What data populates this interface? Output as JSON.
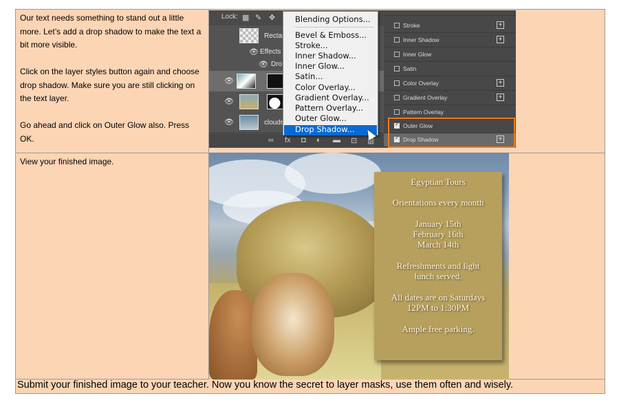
{
  "row1": {
    "paragraphs": [
      "Our text needs something to stand out a little more. Let’s add a drop shadow to make the text a bit more visible.",
      "Click on the layer styles button again and choose drop shadow. Make sure you are still clicking on the text layer.",
      "Go ahead and click on Outer Glow also. Press OK."
    ]
  },
  "row2": {
    "text": "View your finished image."
  },
  "footer": {
    "text": "Submit your finished image to your teacher. Now you know the secret to layer masks, use them often and wisely."
  },
  "layers_panel": {
    "lock_label": "Lock:",
    "layers": [
      "Rectan",
      "Effects",
      "Dro",
      "",
      "",
      "clouds"
    ],
    "menu_items": [
      "Blending Options...",
      "Bevel & Emboss...",
      "Stroke...",
      "Inner Shadow...",
      "Inner Glow...",
      "Satin...",
      "Color Overlay...",
      "Gradient Overlay...",
      "Pattern Overlay...",
      "Outer Glow...",
      "Drop Shadow..."
    ],
    "selected_item": "Drop Shadow..."
  },
  "layer_style_panel": {
    "items": [
      {
        "label": "Stroke",
        "checked": false,
        "plus": true
      },
      {
        "label": "Inner Shadow",
        "checked": false,
        "plus": true
      },
      {
        "label": "Inner Glow",
        "checked": false,
        "plus": false
      },
      {
        "label": "Satin",
        "checked": false,
        "plus": false
      },
      {
        "label": "Color Overlay",
        "checked": false,
        "plus": true
      },
      {
        "label": "Gradient Overlay",
        "checked": false,
        "plus": true
      },
      {
        "label": "Pattern Overlay",
        "checked": false,
        "plus": false
      },
      {
        "label": "Outer Glow",
        "checked": true,
        "plus": false
      },
      {
        "label": "Drop Shadow",
        "checked": true,
        "plus": true
      }
    ],
    "highlight_color": "#f07a1a"
  },
  "poster": {
    "lines": [
      "Egyptian Tours",
      "Orientations every month",
      "January 15th",
      "February 16th",
      "March 14th",
      "Refreshments and light",
      "lunch served.",
      "All dates are on Saturdays",
      "12PM to 1:30PM",
      "Ample free parking."
    ]
  },
  "colors": {
    "cell_bg": "#fcd5b5",
    "menu_highlight": "#0a6ad1"
  }
}
